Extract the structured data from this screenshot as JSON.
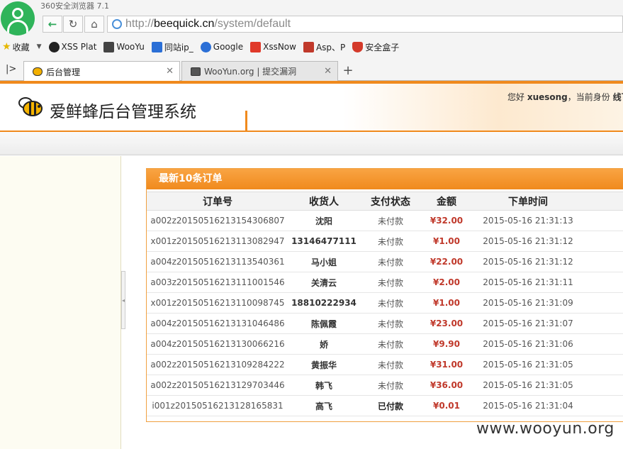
{
  "browser": {
    "title": "360安全浏览器 7.1",
    "url_protocol": "http://",
    "url_domain": "beequick.cn",
    "url_path": "/system/default"
  },
  "bookmarks": [
    {
      "label": "收藏",
      "color": "#e6b800"
    },
    {
      "label": "XSS Plat",
      "color": "#222222"
    },
    {
      "label": "WooYu",
      "color": "#444444"
    },
    {
      "label": "同站ip_",
      "color": "#2b6fd6"
    },
    {
      "label": "Google",
      "color": "#2b6fd6"
    },
    {
      "label": "XssNow",
      "color": "#e03a2a"
    },
    {
      "label": "Asp、P",
      "color": "#c0392b"
    },
    {
      "label": "安全盒子",
      "color": "#d43a2a"
    }
  ],
  "tabs": [
    {
      "label": "后台管理"
    },
    {
      "label": "WooYun.org | 提交漏洞"
    }
  ],
  "site": {
    "title": "爱鲜蜂后台管理系统",
    "greeting_prefix": "您好 ",
    "username": "xuesong",
    "greeting_mid": "，当前身份 ",
    "role": "线下"
  },
  "orders": {
    "title": "最新10条订单",
    "columns": [
      "订单号",
      "收货人",
      "支付状态",
      "金额",
      "下单时间"
    ],
    "rows": [
      {
        "id": "a002z20150516213154306807",
        "receiver": "沈阳",
        "status": "未付款",
        "amount": "¥32.00",
        "time": "2015-05-16 21:31:13"
      },
      {
        "id": "x001z20150516213113082947",
        "receiver": "13146477111",
        "status": "未付款",
        "amount": "¥1.00",
        "time": "2015-05-16 21:31:12"
      },
      {
        "id": "a004z20150516213113540361",
        "receiver": "马小姐",
        "status": "未付款",
        "amount": "¥22.00",
        "time": "2015-05-16 21:31:12"
      },
      {
        "id": "a003z20150516213111001546",
        "receiver": "关清云",
        "status": "未付款",
        "amount": "¥2.00",
        "time": "2015-05-16 21:31:11"
      },
      {
        "id": "x001z20150516213110098745",
        "receiver": "18810222934",
        "status": "未付款",
        "amount": "¥1.00",
        "time": "2015-05-16 21:31:09"
      },
      {
        "id": "a004z20150516213131046486",
        "receiver": "陈佩霞",
        "status": "未付款",
        "amount": "¥23.00",
        "time": "2015-05-16 21:31:07"
      },
      {
        "id": "a004z20150516213130066216",
        "receiver": "娇",
        "status": "未付款",
        "amount": "¥9.90",
        "time": "2015-05-16 21:31:06"
      },
      {
        "id": "a002z20150516213109284222",
        "receiver": "黄振华",
        "status": "未付款",
        "amount": "¥31.00",
        "time": "2015-05-16 21:31:05"
      },
      {
        "id": "a002z20150516213129703446",
        "receiver": "韩飞",
        "status": "未付款",
        "amount": "¥36.00",
        "time": "2015-05-16 21:31:05"
      },
      {
        "id": "i001z20150516213128165831",
        "receiver": "高飞",
        "status": "已付款",
        "amount": "¥0.01",
        "time": "2015-05-16 21:31:04"
      }
    ]
  },
  "watermark": "www.wooyun.org",
  "colors": {
    "accent": "#f08a1d",
    "amount": "#c0392b"
  }
}
